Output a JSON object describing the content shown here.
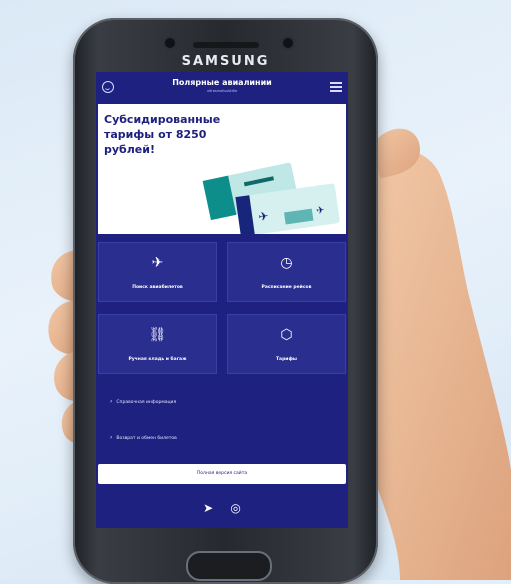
{
  "device": {
    "brand": "SAMSUNG"
  },
  "header": {
    "title": "Полярные авиалинии",
    "subtitle": "ultrasmallsubtitle"
  },
  "banner": {
    "text": "Субсидированные тарифы от 8250 рублей!"
  },
  "tiles": [
    {
      "label": "Поиск авиабилетов",
      "icon": "airplane-icon"
    },
    {
      "label": "Расписание рейсов",
      "icon": "clock-icon"
    },
    {
      "label": "Ручная кладь и багаж",
      "icon": "link-icon"
    },
    {
      "label": "Тарифы",
      "icon": "box-icon"
    }
  ],
  "links": [
    {
      "label": "Справочная информация"
    },
    {
      "label": "Возврат и обмен билетов"
    }
  ],
  "full_version_label": "Полная версия сайта",
  "social": [
    {
      "icon": "telegram-icon"
    },
    {
      "icon": "instagram-icon"
    }
  ],
  "colors": {
    "primary": "#1f2180",
    "tile": "#2a2e8f",
    "banner_bg": "#ffffff"
  }
}
